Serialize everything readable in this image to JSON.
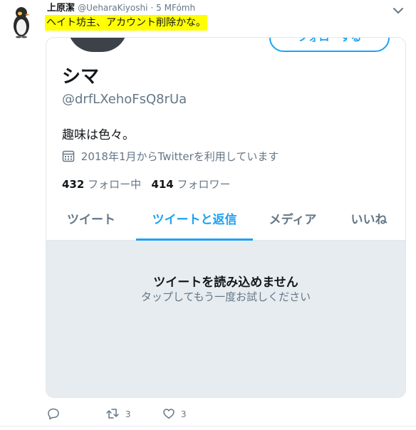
{
  "tweet": {
    "author_name": "上原潔",
    "author_handle": "@UeharaKiyoshi",
    "time": "· 5 MFómh",
    "text": "ヘイト坊主、アカウント削除かな。"
  },
  "card": {
    "follow_label": "フォローする",
    "name": "シマ",
    "handle": "@drfLXehoFsQ8rUa",
    "bio": "趣味は色々。",
    "joined": "2018年1月からTwitterを利用しています",
    "following_count": "432",
    "following_label": "フォロー中",
    "followers_count": "414",
    "followers_label": "フォロワー",
    "tabs": [
      {
        "label": "ツイート",
        "active": false
      },
      {
        "label": "ツイートと返信",
        "active": true
      },
      {
        "label": "メディア",
        "active": false
      },
      {
        "label": "いいね",
        "active": false
      }
    ],
    "empty_title": "ツイートを読み込めません",
    "empty_subtitle": "タップしてもう一度お試しください"
  },
  "actions": {
    "reply_icon": "reply-icon",
    "retweet_count": "3",
    "like_count": "3"
  },
  "colors": {
    "accent": "#1da1f2",
    "highlight": "#ffff00",
    "muted": "#657786",
    "empty_bg": "#e6ecf0"
  }
}
